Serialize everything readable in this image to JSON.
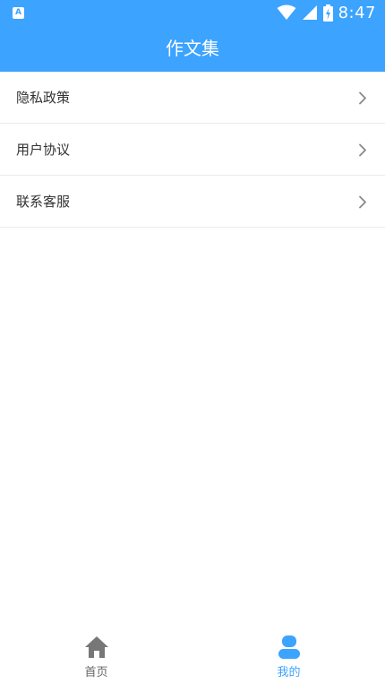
{
  "status_bar": {
    "app_icon_letter": "A",
    "time": "8:47"
  },
  "header": {
    "title": "作文集"
  },
  "menu": {
    "items": [
      {
        "label": "隐私政策"
      },
      {
        "label": "用户协议"
      },
      {
        "label": "联系客服"
      }
    ]
  },
  "tabs": [
    {
      "label": "首页",
      "icon": "home-icon",
      "active": false
    },
    {
      "label": "我的",
      "icon": "user-icon",
      "active": true
    }
  ],
  "colors": {
    "accent": "#3ca3ff",
    "inactive": "#666666",
    "text": "#333333",
    "divider": "#ebebeb"
  }
}
